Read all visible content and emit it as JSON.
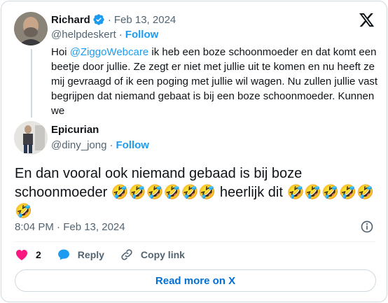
{
  "quoted_tweet": {
    "author_name": "Richard",
    "date": "Feb 13, 2024",
    "handle": "@helpdeskert",
    "follow_label": "Follow",
    "text_before_mention": "Hoi ",
    "mention": "@ZiggoWebcare",
    "text_after_mention": " ik heb een boze schoonmoeder en dat komt een beetje door jullie. Ze zegt er niet met jullie uit te komen en nu heeft ze mij gevraagd of ik een poging met jullie wil wagen. Nu zullen jullie vast begrijpen dat niemand gebaat is bij een boze schoonmoeder. Kunnen we"
  },
  "reply_tweet": {
    "author_name": "Epicurian",
    "handle": "@diny_jong",
    "follow_label": "Follow",
    "text_part1": "En dan vooral ook niemand gebaad is bij boze schoonmoeder ",
    "emojis_1": "🤣🤣🤣🤣🤣🤣",
    "text_part2": " heerlijk dit ",
    "emojis_2": "🤣🤣🤣🤣🤣🤣",
    "timestamp": "8:04 PM · Feb 13, 2024"
  },
  "actions": {
    "like_count": "2",
    "reply_label": "Reply",
    "copy_link_label": "Copy link"
  },
  "read_more_label": "Read more on X",
  "separator": "·",
  "icons": [
    "verified-badge-icon",
    "x-logo-icon",
    "info-icon",
    "heart-icon",
    "reply-icon",
    "link-icon"
  ],
  "colors": {
    "accent": "#1d9bf0",
    "link": "#006fd6",
    "like": "#f91880",
    "muted": "#536471",
    "border": "#cfd9de"
  }
}
